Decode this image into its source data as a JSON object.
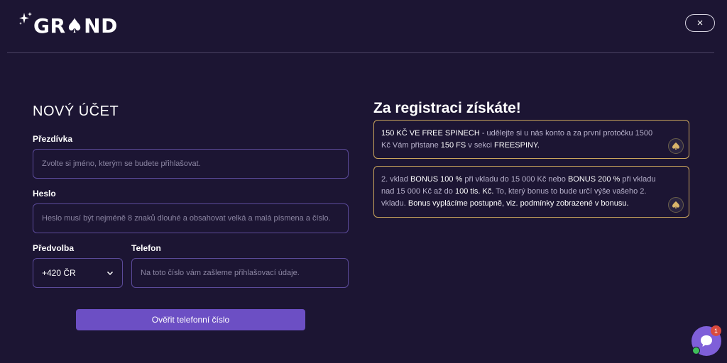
{
  "header": {
    "logo_text": "GR♠ND",
    "close_label": "×"
  },
  "form": {
    "title": "NOVÝ ÚČET",
    "nickname": {
      "label": "Přezdívka",
      "placeholder": "Zvolte si jméno, kterým se budete přihlašovat."
    },
    "password": {
      "label": "Heslo",
      "placeholder": "Heslo musí být nejméně 8 znaků dlouhé a obsahovat velká a malá písmena a číslo."
    },
    "prefix": {
      "label": "Předvolba",
      "value": "+420 ČR"
    },
    "phone": {
      "label": "Telefon",
      "placeholder": "Na toto číslo vám zašleme přihlašovací údaje."
    },
    "verify_button": "Ověřit telefonní číslo"
  },
  "bonus": {
    "title": "Za registraci získáte!",
    "card1": {
      "p1": "150 KČ VE FREE SPINECH",
      "p2": " - udělejte si u nás konto a za první protočku 1500 Kč Vám přistane ",
      "p3": "150 FS",
      "p4": " v sekci ",
      "p5": "FREESPINY."
    },
    "card2": {
      "p1": "2. vklad ",
      "p2": "BONUS 100 %",
      "p3": " při vkladu do 15 000 Kč nebo ",
      "p4": "BONUS 200 %",
      "p5": " při vkladu nad 15 000 Kč až do ",
      "p6": "100 tis. Kč.",
      "p7": " To, který bonus to bude určí výše vašeho 2. vkladu. ",
      "p8": "Bonus vyplácíme postupně, viz. podmínky zobrazené v bonusu."
    }
  },
  "chat": {
    "badge_count": "1"
  },
  "colors": {
    "background": "#1c1533",
    "accent": "#6c4fc4",
    "gold_border": "#c9a45c"
  },
  "icons": [
    "sparkle-icon",
    "spade-icon",
    "close-icon",
    "chevron-down-icon",
    "bonus-coin-icon",
    "chat-icon"
  ]
}
